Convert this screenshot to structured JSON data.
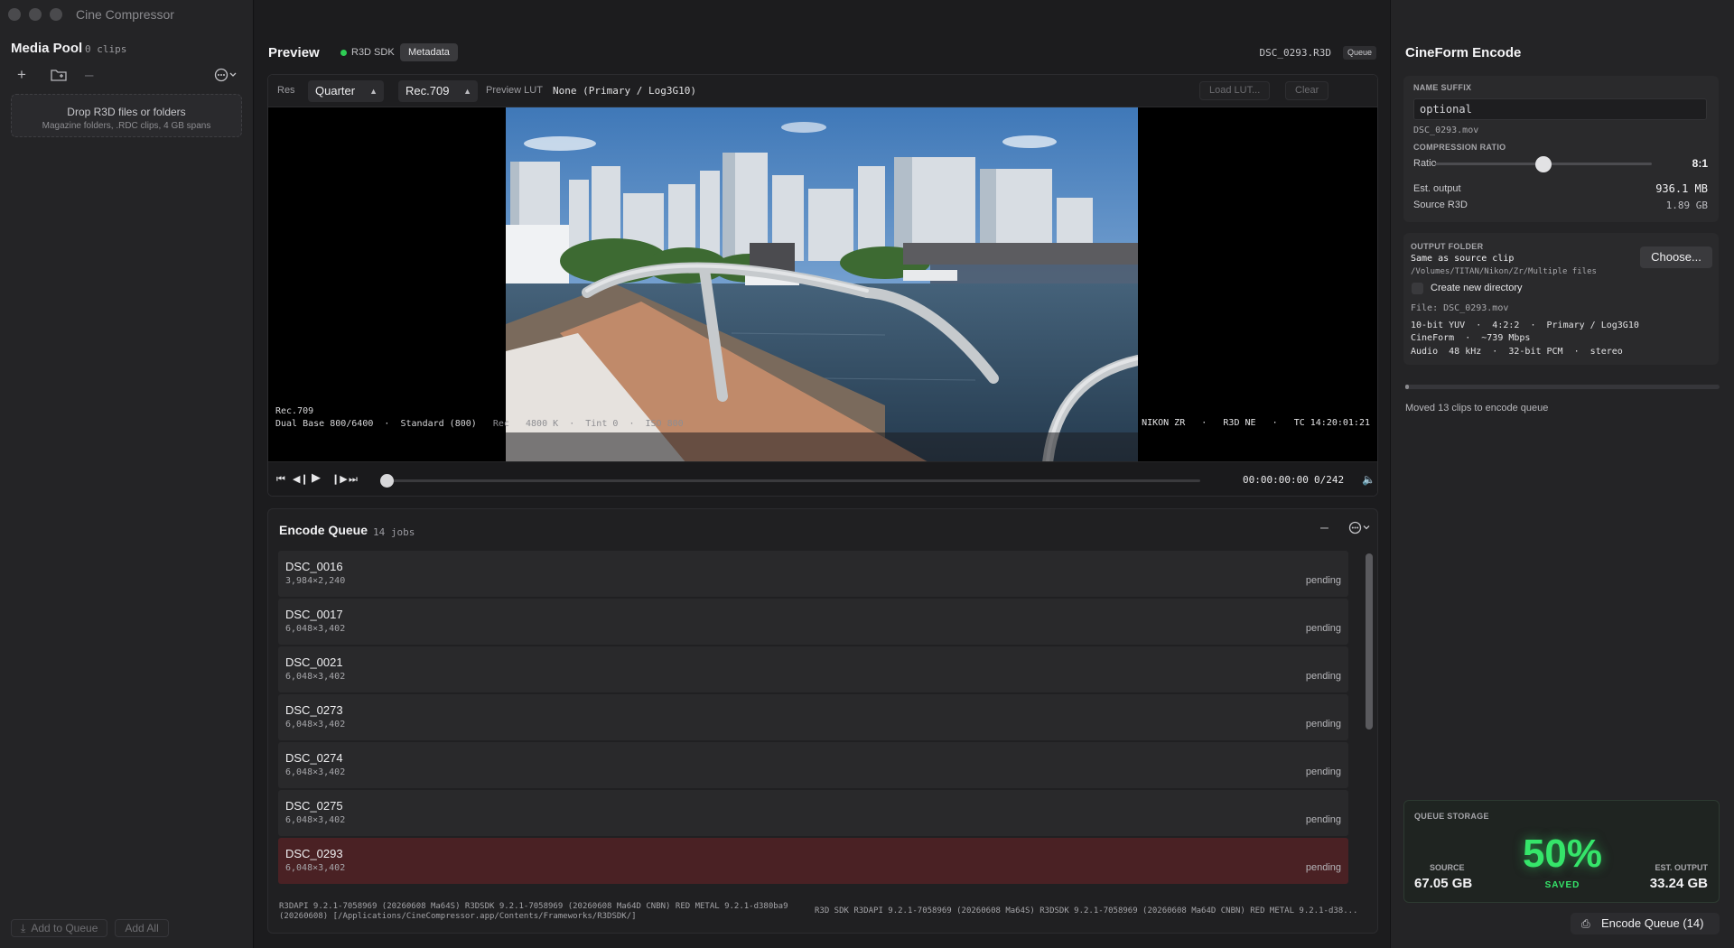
{
  "app": {
    "title": "Cine Compressor"
  },
  "media_pool": {
    "title": "Media Pool",
    "count": "0 clips",
    "toolbar_icons": [
      "plus-icon",
      "folder-add-icon",
      "minus-icon",
      "more-menu-icon"
    ],
    "drop_title": "Drop R3D files or folders",
    "drop_subtitle": "Magazine folders, .RDC clips, 4 GB spans",
    "add_to_queue": "Add to Queue",
    "add_all": "Add All"
  },
  "preview": {
    "title": "Preview",
    "sdk_badge": "R3D SDK",
    "metadata_label": "Metadata",
    "filename": "DSC_0293.R3D",
    "queue_pill": "Queue",
    "res_label": "Res",
    "res_value": "Quarter",
    "colorspace_value": "Rec.709",
    "lut_label": "Preview LUT",
    "lut_value": "None (Primary / Log3G10)",
    "load_lut": "Load LUT...",
    "clear": "Clear",
    "overlay_colorspace": "Rec.709",
    "overlay_iso_mode": "Dual Base 800/6400",
    "overlay_mode": "Standard (800)",
    "overlay_rec_label": "Rec",
    "overlay_kelvin": "4800 K",
    "overlay_tint": "Tint 0",
    "overlay_iso": "ISO 800",
    "overlay_camera": "NIKON ZR",
    "overlay_codec": "R3D NE",
    "overlay_tc": "TC 14:20:01:21",
    "timecode": "00:00:00:00",
    "frames": "0/242",
    "playhead": 0
  },
  "queue": {
    "title": "Encode Queue",
    "count": "14 jobs",
    "rows": [
      {
        "name": "DSC_0016",
        "dims": "3,984×2,240",
        "status": "pending"
      },
      {
        "name": "DSC_0017",
        "dims": "6,048×3,402",
        "status": "pending"
      },
      {
        "name": "DSC_0021",
        "dims": "6,048×3,402",
        "status": "pending"
      },
      {
        "name": "DSC_0273",
        "dims": "6,048×3,402",
        "status": "pending"
      },
      {
        "name": "DSC_0274",
        "dims": "6,048×3,402",
        "status": "pending"
      },
      {
        "name": "DSC_0275",
        "dims": "6,048×3,402",
        "status": "pending"
      },
      {
        "name": "DSC_0293",
        "dims": "6,048×3,402",
        "status": "pending",
        "selected": true
      }
    ],
    "sdk_info_left": "R3DAPI 9.2.1-7058969 (20260608 Ma64S) R3DSDK 9.2.1-7058969 (20260608 Ma64D CNBN) RED METAL 9.2.1-d380ba9 (20260608) [/Applications/CineCompressor.app/Contents/Frameworks/R3DSDK/]",
    "sdk_info_right": "R3D SDK R3DAPI 9.2.1-7058969 (20260608 Ma64S) R3DSDK 9.2.1-7058969 (20260608 Ma64D CNBN) RED METAL 9.2.1-d38..."
  },
  "encode": {
    "title": "CineForm Encode",
    "name_suffix_label": "NAME SUFFIX",
    "name_suffix_placeholder": "optional",
    "output_name": "DSC_0293.mov",
    "ratio_section": "COMPRESSION RATIO",
    "ratio_label": "Ratio",
    "ratio_value": "8:1",
    "ratio_position": 0.5,
    "est_output_label": "Est. output",
    "est_output_value": "936.1 MB",
    "source_label": "Source R3D",
    "source_value": "1.89 GB",
    "output_folder_label": "OUTPUT FOLDER",
    "output_folder_value": "Same as source clip",
    "output_path": "/Volumes/TITAN/Nikon/Zr/Multiple files",
    "choose": "Choose...",
    "new_dir_label": "Create new directory",
    "new_dir_checked": false,
    "file_line": "File: DSC_0293.mov",
    "spec_line1": "10-bit YUV  ·  4:2:2  ·  Primary / Log3G10",
    "spec_line2": "CineForm  ·  ~739 Mbps",
    "spec_line3": "Audio  48 kHz  ·  32-bit PCM  ·  stereo",
    "progress": 0.01,
    "progress_message": "Moved 13 clips to encode queue"
  },
  "storage": {
    "label": "QUEUE STORAGE",
    "source_label": "SOURCE",
    "source_value": "67.05 GB",
    "pct": "50%",
    "saved": "SAVED",
    "est_label": "EST. OUTPUT",
    "est_value": "33.24 GB"
  },
  "encode_button": "Encode Queue (14)",
  "colors": {
    "accent_green": "#35e56a",
    "selected_row": "#4a2124",
    "status_dot": "#2ecc54"
  }
}
